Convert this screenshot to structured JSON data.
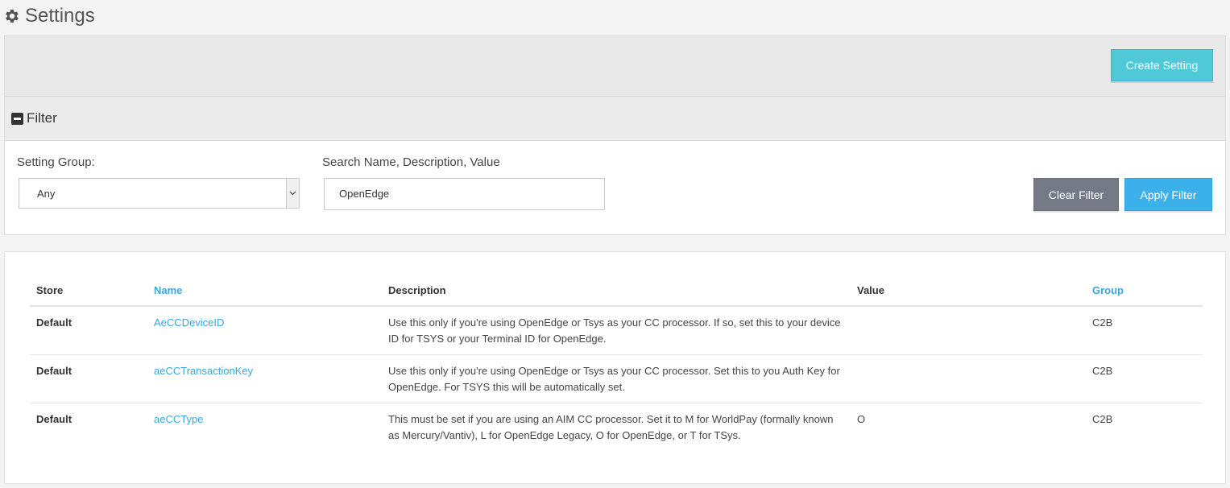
{
  "page": {
    "title": "Settings",
    "icon": "gear-icon"
  },
  "toolbar": {
    "create_label": "Create Setting"
  },
  "filter": {
    "title": "Filter",
    "toggle_icon": "collapse-minus-icon",
    "group_label": "Setting Group:",
    "group_value": "Any",
    "search_label": "Search Name, Description, Value",
    "search_value": "OpenEdge",
    "clear_label": "Clear Filter",
    "apply_label": "Apply Filter"
  },
  "table": {
    "headers": [
      "Store",
      "Name",
      "Description",
      "Value",
      "Group"
    ],
    "rows": [
      {
        "store": "Default",
        "name": "AeCCDeviceID",
        "description": "Use this only if you're using OpenEdge or Tsys as your CC processor. If so, set this to your device ID for TSYS or your Terminal ID for OpenEdge.",
        "value": "",
        "group": "C2B"
      },
      {
        "store": "Default",
        "name": "aeCCTransactionKey",
        "description": "Use this only if you're using OpenEdge or Tsys as your CC processor. Set this to you Auth Key for OpenEdge. For TSYS this will be automatically set.",
        "value": "",
        "group": "C2B"
      },
      {
        "store": "Default",
        "name": "aeCCType",
        "description": "This must be set if you are using an AIM CC processor. Set it to M for WorldPay (formally known as Mercury/Vantiv), L for OpenEdge Legacy, O for OpenEdge, or T for TSys.",
        "value": "O",
        "group": "C2B"
      }
    ]
  },
  "colors": {
    "link": "#3aa6d8",
    "create_button": "#4fc9d8",
    "clear_button": "#757a86",
    "apply_button": "#3cb0ea"
  }
}
